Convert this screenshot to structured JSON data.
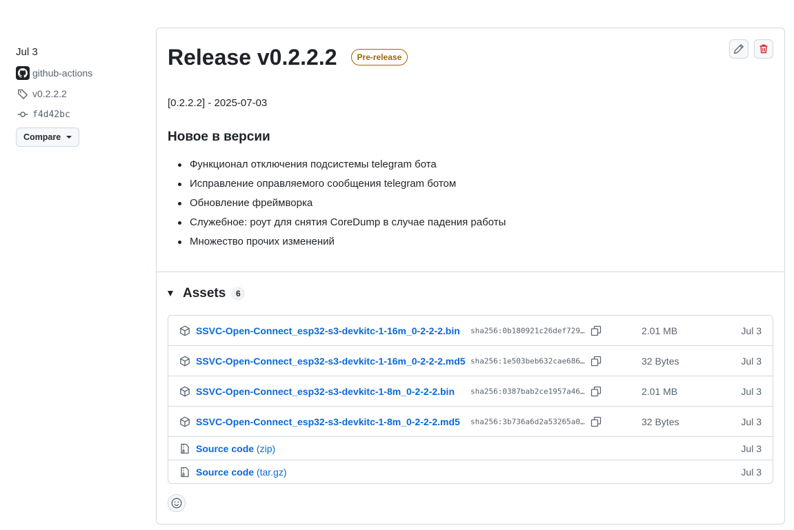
{
  "sidebar": {
    "date": "Jul 3",
    "author": "github-actions",
    "tag": "v0.2.2.2",
    "commit": "f4d42bc",
    "compare_label": "Compare"
  },
  "release": {
    "title": "Release v0.2.2.2",
    "badge": "Pre-release",
    "version_line": "[0.2.2.2] - 2025-07-03",
    "section_heading": "Новое в версии",
    "notes": [
      "Функционал отключения подсистемы telegram бота",
      "Исправление оправляемого сообщения telegram ботом",
      "Обновление фреймворка",
      "Служебное: роут для снятия CoreDump в случае падения работы",
      "Множество прочих изменений"
    ]
  },
  "assets": {
    "title": "Assets",
    "count": "6",
    "files": [
      {
        "name": "SSVC-Open-Connect_esp32-s3-devkitc-1-16m_0-2-2-2.bin",
        "sha": "sha256:0b180921c26def729…",
        "size": "2.01 MB",
        "date": "Jul 3"
      },
      {
        "name": "SSVC-Open-Connect_esp32-s3-devkitc-1-16m_0-2-2-2.md5",
        "sha": "sha256:1e503beb632cae686…",
        "size": "32 Bytes",
        "date": "Jul 3"
      },
      {
        "name": "SSVC-Open-Connect_esp32-s3-devkitc-1-8m_0-2-2-2.bin",
        "sha": "sha256:0387bab2ce1957a46…",
        "size": "2.01 MB",
        "date": "Jul 3"
      },
      {
        "name": "SSVC-Open-Connect_esp32-s3-devkitc-1-8m_0-2-2-2.md5",
        "sha": "sha256:3b736a6d2a53265a0…",
        "size": "32 Bytes",
        "date": "Jul 3"
      }
    ],
    "sources": [
      {
        "name": "Source code",
        "format": "(zip)",
        "date": "Jul 3"
      },
      {
        "name": "Source code",
        "format": "(tar.gz)",
        "date": "Jul 3"
      }
    ]
  },
  "icons": {
    "author_avatar": "github-mark-icon",
    "tag": "tag-icon",
    "commit": "git-commit-icon",
    "edit": "pencil-icon",
    "delete": "trash-icon",
    "asset": "package-icon",
    "source": "file-zip-icon",
    "copy": "copy-icon",
    "reaction": "smiley-icon"
  },
  "colors": {
    "link": "#0969da",
    "badge": "#9a6700",
    "danger": "#d1242f",
    "muted": "#59636e"
  }
}
